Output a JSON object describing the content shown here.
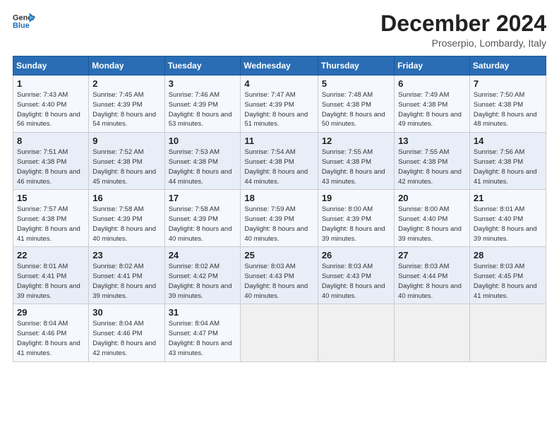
{
  "logo": {
    "line1": "General",
    "line2": "Blue"
  },
  "title": "December 2024",
  "subtitle": "Proserpio, Lombardy, Italy",
  "weekdays": [
    "Sunday",
    "Monday",
    "Tuesday",
    "Wednesday",
    "Thursday",
    "Friday",
    "Saturday"
  ],
  "weeks": [
    [
      {
        "day": "1",
        "rise": "7:43 AM",
        "set": "4:40 PM",
        "daylight": "8 hours and 56 minutes."
      },
      {
        "day": "2",
        "rise": "7:45 AM",
        "set": "4:39 PM",
        "daylight": "8 hours and 54 minutes."
      },
      {
        "day": "3",
        "rise": "7:46 AM",
        "set": "4:39 PM",
        "daylight": "8 hours and 53 minutes."
      },
      {
        "day": "4",
        "rise": "7:47 AM",
        "set": "4:39 PM",
        "daylight": "8 hours and 51 minutes."
      },
      {
        "day": "5",
        "rise": "7:48 AM",
        "set": "4:38 PM",
        "daylight": "8 hours and 50 minutes."
      },
      {
        "day": "6",
        "rise": "7:49 AM",
        "set": "4:38 PM",
        "daylight": "8 hours and 49 minutes."
      },
      {
        "day": "7",
        "rise": "7:50 AM",
        "set": "4:38 PM",
        "daylight": "8 hours and 48 minutes."
      }
    ],
    [
      {
        "day": "8",
        "rise": "7:51 AM",
        "set": "4:38 PM",
        "daylight": "8 hours and 46 minutes."
      },
      {
        "day": "9",
        "rise": "7:52 AM",
        "set": "4:38 PM",
        "daylight": "8 hours and 45 minutes."
      },
      {
        "day": "10",
        "rise": "7:53 AM",
        "set": "4:38 PM",
        "daylight": "8 hours and 44 minutes."
      },
      {
        "day": "11",
        "rise": "7:54 AM",
        "set": "4:38 PM",
        "daylight": "8 hours and 44 minutes."
      },
      {
        "day": "12",
        "rise": "7:55 AM",
        "set": "4:38 PM",
        "daylight": "8 hours and 43 minutes."
      },
      {
        "day": "13",
        "rise": "7:55 AM",
        "set": "4:38 PM",
        "daylight": "8 hours and 42 minutes."
      },
      {
        "day": "14",
        "rise": "7:56 AM",
        "set": "4:38 PM",
        "daylight": "8 hours and 41 minutes."
      }
    ],
    [
      {
        "day": "15",
        "rise": "7:57 AM",
        "set": "4:38 PM",
        "daylight": "8 hours and 41 minutes."
      },
      {
        "day": "16",
        "rise": "7:58 AM",
        "set": "4:39 PM",
        "daylight": "8 hours and 40 minutes."
      },
      {
        "day": "17",
        "rise": "7:58 AM",
        "set": "4:39 PM",
        "daylight": "8 hours and 40 minutes."
      },
      {
        "day": "18",
        "rise": "7:59 AM",
        "set": "4:39 PM",
        "daylight": "8 hours and 40 minutes."
      },
      {
        "day": "19",
        "rise": "8:00 AM",
        "set": "4:39 PM",
        "daylight": "8 hours and 39 minutes."
      },
      {
        "day": "20",
        "rise": "8:00 AM",
        "set": "4:40 PM",
        "daylight": "8 hours and 39 minutes."
      },
      {
        "day": "21",
        "rise": "8:01 AM",
        "set": "4:40 PM",
        "daylight": "8 hours and 39 minutes."
      }
    ],
    [
      {
        "day": "22",
        "rise": "8:01 AM",
        "set": "4:41 PM",
        "daylight": "8 hours and 39 minutes."
      },
      {
        "day": "23",
        "rise": "8:02 AM",
        "set": "4:41 PM",
        "daylight": "8 hours and 39 minutes."
      },
      {
        "day": "24",
        "rise": "8:02 AM",
        "set": "4:42 PM",
        "daylight": "8 hours and 39 minutes."
      },
      {
        "day": "25",
        "rise": "8:03 AM",
        "set": "4:43 PM",
        "daylight": "8 hours and 40 minutes."
      },
      {
        "day": "26",
        "rise": "8:03 AM",
        "set": "4:43 PM",
        "daylight": "8 hours and 40 minutes."
      },
      {
        "day": "27",
        "rise": "8:03 AM",
        "set": "4:44 PM",
        "daylight": "8 hours and 40 minutes."
      },
      {
        "day": "28",
        "rise": "8:03 AM",
        "set": "4:45 PM",
        "daylight": "8 hours and 41 minutes."
      }
    ],
    [
      {
        "day": "29",
        "rise": "8:04 AM",
        "set": "4:46 PM",
        "daylight": "8 hours and 41 minutes."
      },
      {
        "day": "30",
        "rise": "8:04 AM",
        "set": "4:46 PM",
        "daylight": "8 hours and 42 minutes."
      },
      {
        "day": "31",
        "rise": "8:04 AM",
        "set": "4:47 PM",
        "daylight": "8 hours and 43 minutes."
      },
      null,
      null,
      null,
      null
    ]
  ]
}
